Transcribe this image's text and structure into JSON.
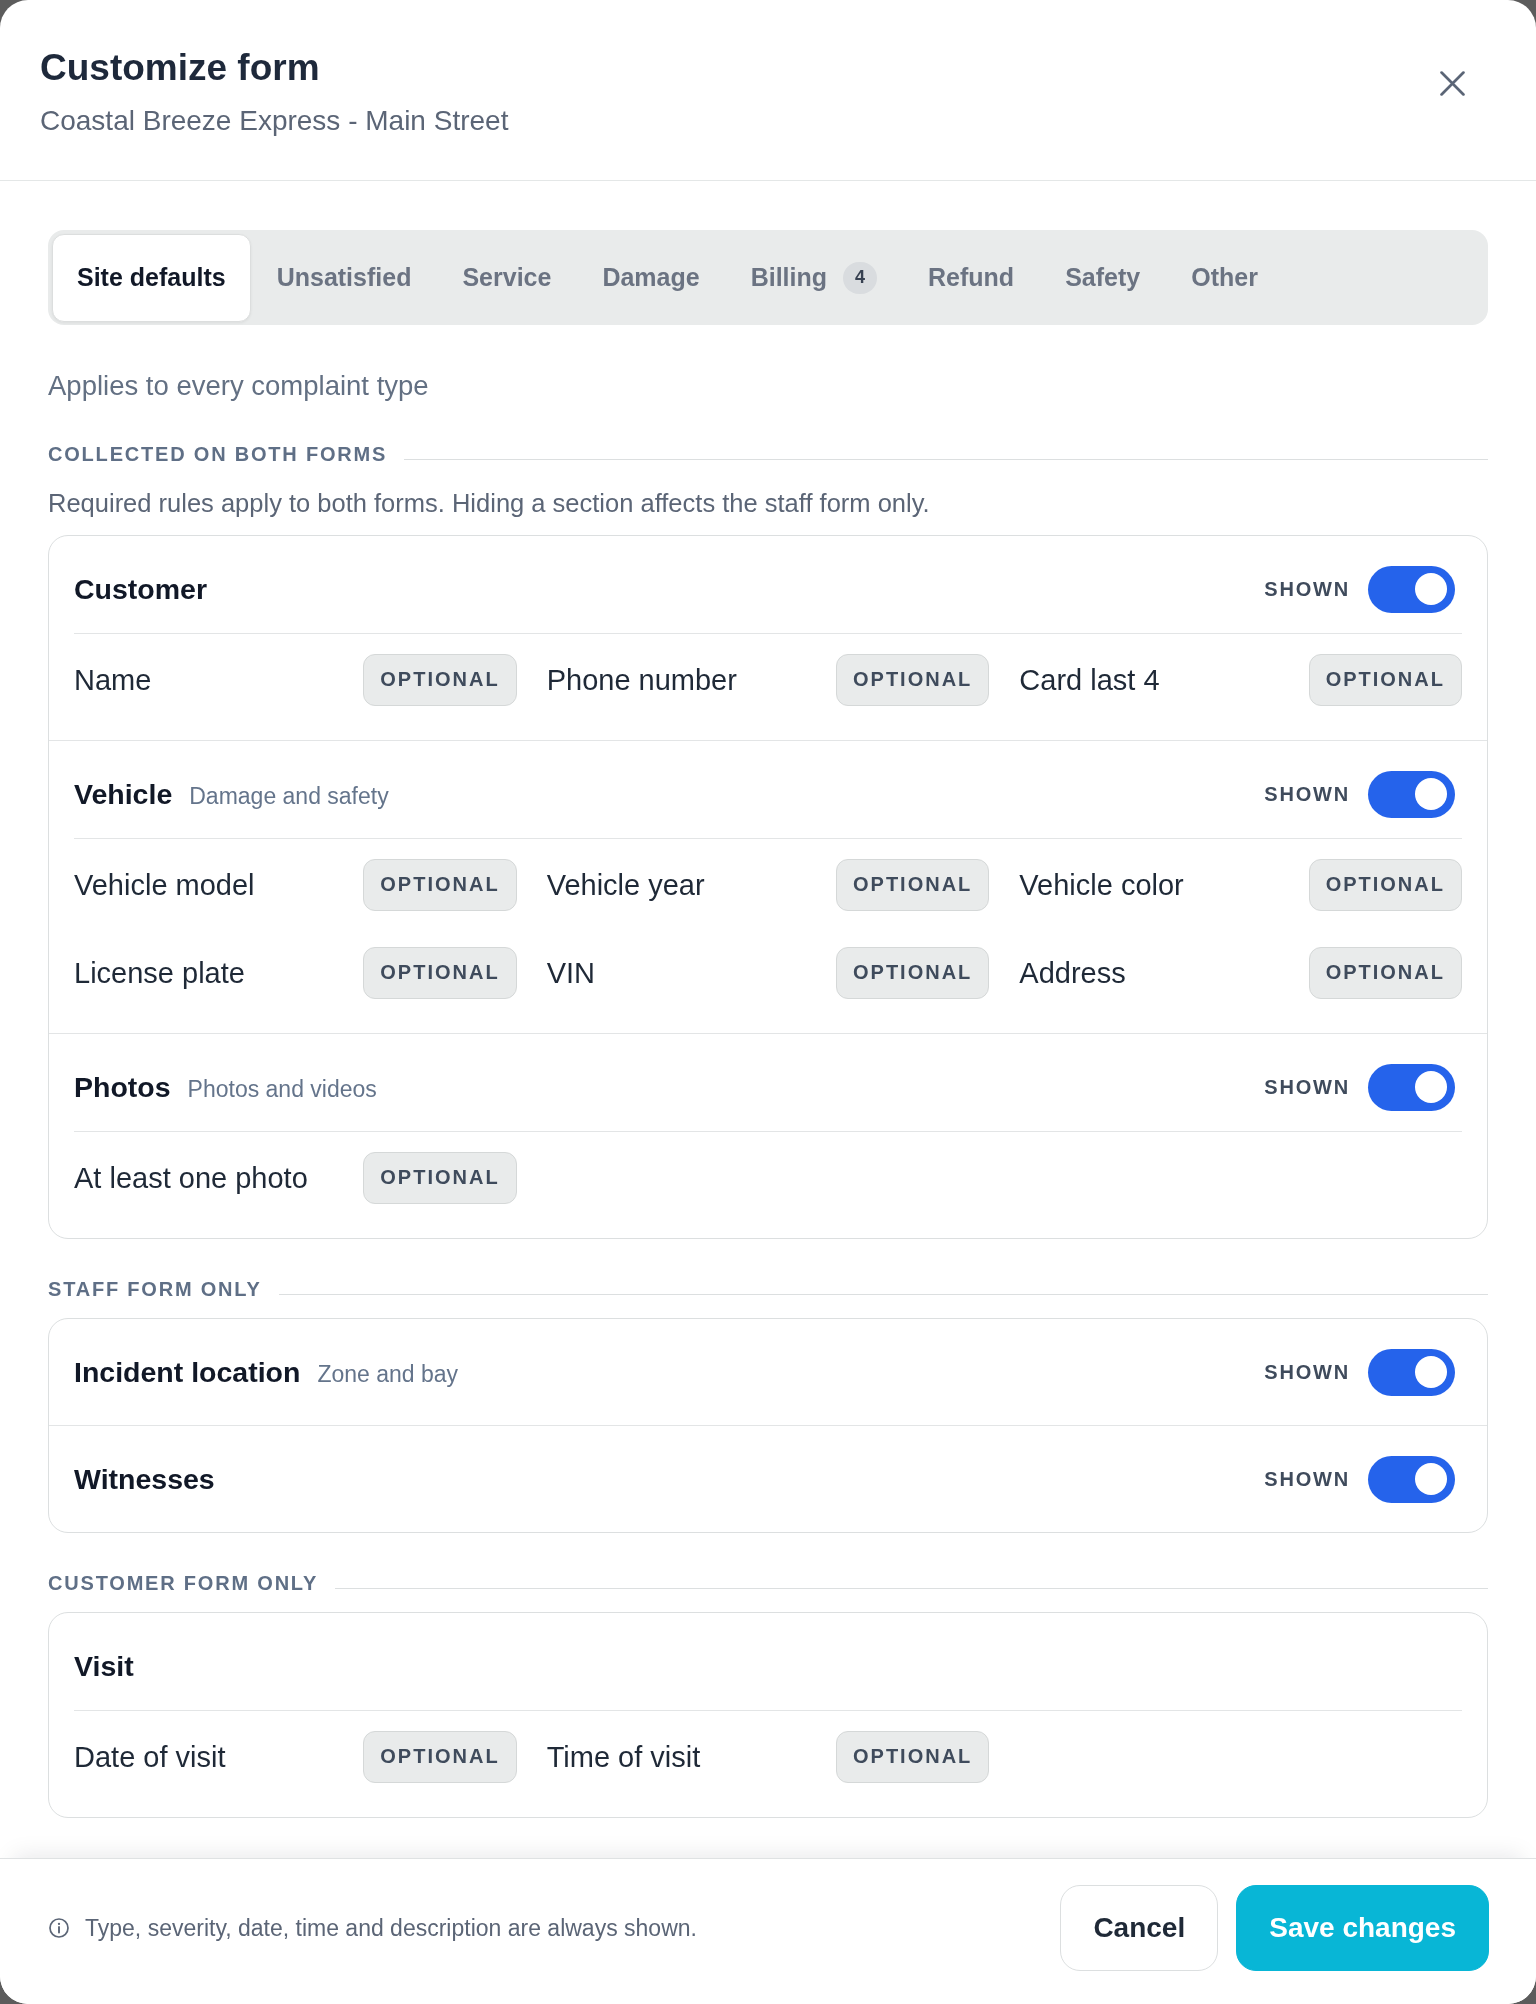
{
  "dialog": {
    "title": "Customize form",
    "subtitle": "Coastal Breeze Express - Main Street"
  },
  "tabs": [
    {
      "label": "Site defaults",
      "selected": true
    },
    {
      "label": "Unsatisfied",
      "selected": false
    },
    {
      "label": "Service",
      "selected": false
    },
    {
      "label": "Damage",
      "selected": false
    },
    {
      "label": "Billing",
      "count": "4",
      "selected": false
    },
    {
      "label": "Refund",
      "selected": false
    },
    {
      "label": "Safety",
      "selected": false
    },
    {
      "label": "Other",
      "selected": false
    }
  ],
  "scope_note": "Applies to every complaint type",
  "groups": [
    {
      "heading": "COLLECTED ON BOTH FORMS",
      "note": "Required rules apply to both forms. Hiding a section affects the staff form only.",
      "sections": [
        {
          "title": "Customer",
          "toggle": {
            "label": "SHOWN",
            "on": true
          },
          "fields": [
            {
              "label": "Name",
              "requirement": "OPTIONAL"
            },
            {
              "label": "Phone number",
              "requirement": "OPTIONAL"
            },
            {
              "label": "Card last 4",
              "requirement": "OPTIONAL"
            }
          ]
        },
        {
          "title": "Vehicle",
          "description": "Damage and safety",
          "toggle": {
            "label": "SHOWN",
            "on": true
          },
          "fields": [
            {
              "label": "Vehicle model",
              "requirement": "OPTIONAL"
            },
            {
              "label": "Vehicle year",
              "requirement": "OPTIONAL"
            },
            {
              "label": "Vehicle color",
              "requirement": "OPTIONAL"
            },
            {
              "label": "License plate",
              "requirement": "OPTIONAL"
            },
            {
              "label": "VIN",
              "requirement": "OPTIONAL"
            },
            {
              "label": "Address",
              "requirement": "OPTIONAL"
            }
          ]
        },
        {
          "title": "Photos",
          "description": "Photos and videos",
          "toggle": {
            "label": "SHOWN",
            "on": true
          },
          "fields": [
            {
              "label": "At least one photo",
              "requirement": "OPTIONAL"
            }
          ]
        }
      ]
    },
    {
      "heading": "STAFF FORM ONLY",
      "sections": [
        {
          "title": "Incident location",
          "description": "Zone and bay",
          "toggle": {
            "label": "SHOWN",
            "on": true
          }
        },
        {
          "title": "Witnesses",
          "toggle": {
            "label": "SHOWN",
            "on": true
          }
        }
      ]
    },
    {
      "heading": "CUSTOMER FORM ONLY",
      "sections": [
        {
          "title": "Visit",
          "fields": [
            {
              "label": "Date of visit",
              "requirement": "OPTIONAL"
            },
            {
              "label": "Time of visit",
              "requirement": "OPTIONAL"
            }
          ]
        }
      ]
    }
  ],
  "footer": {
    "note": "Type, severity, date, time and description are always shown.",
    "buttons": [
      {
        "label": "Cancel",
        "kind": "secondary"
      },
      {
        "label": "Save changes",
        "kind": "primary"
      }
    ]
  }
}
